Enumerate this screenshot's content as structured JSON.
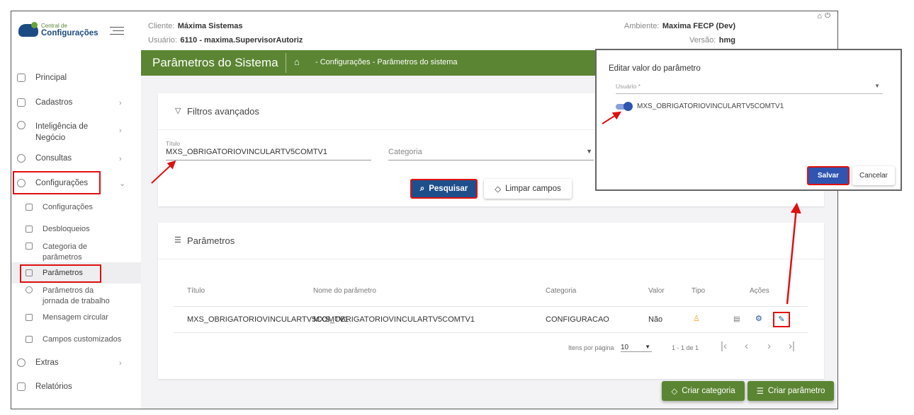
{
  "header": {
    "logo_small": "Central de",
    "logo_big": "Configurações",
    "cliente_label": "Cliente:",
    "cliente": "Máxima Sistemas",
    "usuario_label": "Usuário:",
    "usuario": "6110 - maxima.SupervisorAutoriz",
    "ambiente_label": "Ambiente:",
    "ambiente": "Maxima FECP (Dev)",
    "versao_label": "Versão:",
    "versao": "hmg"
  },
  "sidebar": {
    "items": [
      {
        "label": "Principal"
      },
      {
        "label": "Cadastros"
      },
      {
        "label": "Inteligência de Negócio"
      },
      {
        "label": "Consultas"
      },
      {
        "label": "Configurações"
      },
      {
        "label": "Extras"
      },
      {
        "label": "Relatórios"
      }
    ],
    "subitems": [
      {
        "label": "Configurações"
      },
      {
        "label": "Desbloqueios"
      },
      {
        "label": "Categoria de parâmetros"
      },
      {
        "label": "Parâmetros"
      },
      {
        "label": "Parâmetros da jornada de trabalho"
      },
      {
        "label": "Mensagem circular"
      },
      {
        "label": "Campos customizados"
      }
    ]
  },
  "page": {
    "title": "Parâmetros do Sistema",
    "breadcrumb": "- Configurações - Parâmetros do sistema"
  },
  "filters": {
    "title": "Filtros avançados",
    "titulo_label": "Título",
    "titulo_value": "MXS_OBRIGATORIOVINCULARTV5COMTV1",
    "categoria_placeholder": "Categoria",
    "search": "Pesquisar",
    "clear": "Limpar campos"
  },
  "params": {
    "title": "Parâmetros",
    "columns": [
      "Título",
      "Nome do parâmetro",
      "Categoria",
      "Valor",
      "Tipo",
      "Ações"
    ],
    "rows": [
      {
        "titulo": "MXS_OBRIGATORIOVINCULARTV5COMTV1",
        "nome": "MXS_OBRIGATORIOVINCULARTV5COMTV1",
        "categoria": "CONFIGURACAO",
        "valor": "Não"
      }
    ],
    "per_page_label": "Itens por página",
    "per_page": "10",
    "range": "1 - 1 de 1"
  },
  "actions": {
    "create_category": "Criar categoria",
    "create_param": "Criar parâmetro"
  },
  "modal": {
    "title": "Editar valor do parâmetro",
    "user_placeholder": "Usuário *",
    "toggle_label": "MXS_OBRIGATORIOVINCULARTV5COMTV1",
    "toggle_on": true,
    "save": "Salvar",
    "cancel": "Cancelar"
  }
}
